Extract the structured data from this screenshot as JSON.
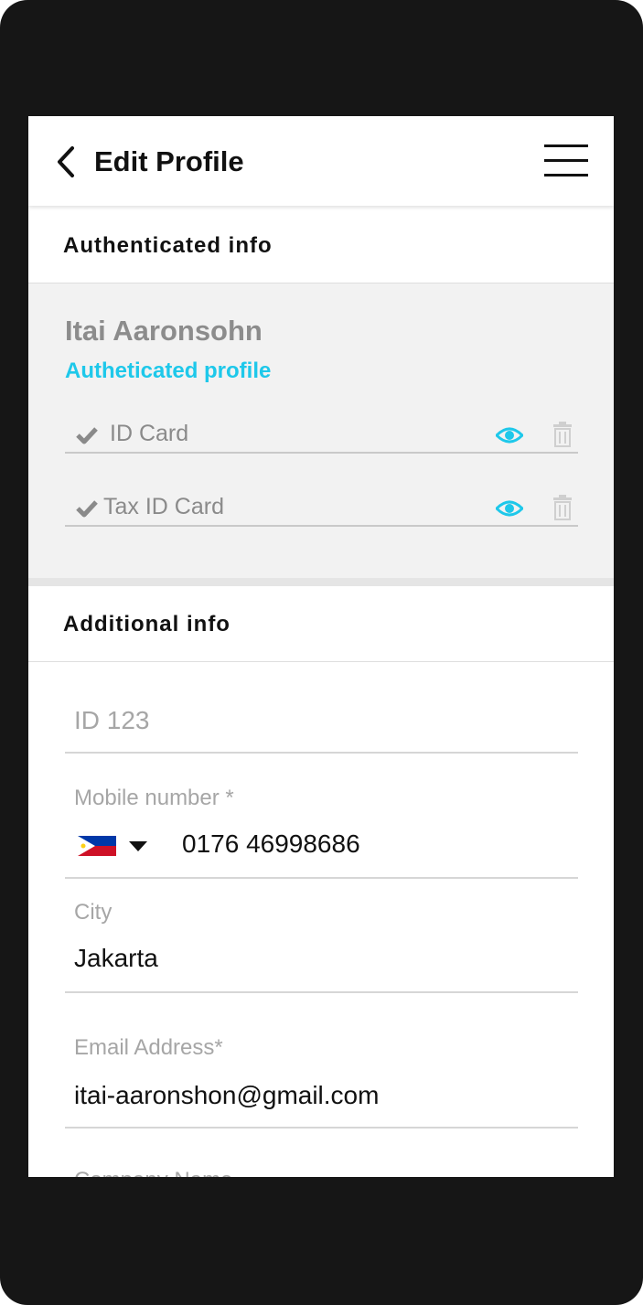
{
  "header": {
    "title": "Edit Profile"
  },
  "authenticated": {
    "section_title": "Authenticated info",
    "name": "Itai Aaronsohn",
    "status": "Autheticated profile",
    "documents": [
      {
        "label": "ID Card"
      },
      {
        "label": "Tax ID Card"
      }
    ]
  },
  "additional": {
    "section_title": "Additional info",
    "id_field": {
      "placeholder": "ID 123"
    },
    "mobile": {
      "label": "Mobile number *",
      "value": "0176 46998686",
      "country": "Philippines"
    },
    "city": {
      "label": "City",
      "value": "Jakarta"
    },
    "email": {
      "label": "Email Address*",
      "value": "itai-aaronshon@gmail.com"
    },
    "next_field": {
      "label": "Company Name"
    }
  },
  "colors": {
    "accent": "#1ec8ea",
    "frame": "#161616",
    "panel": "#f2f2f2"
  }
}
